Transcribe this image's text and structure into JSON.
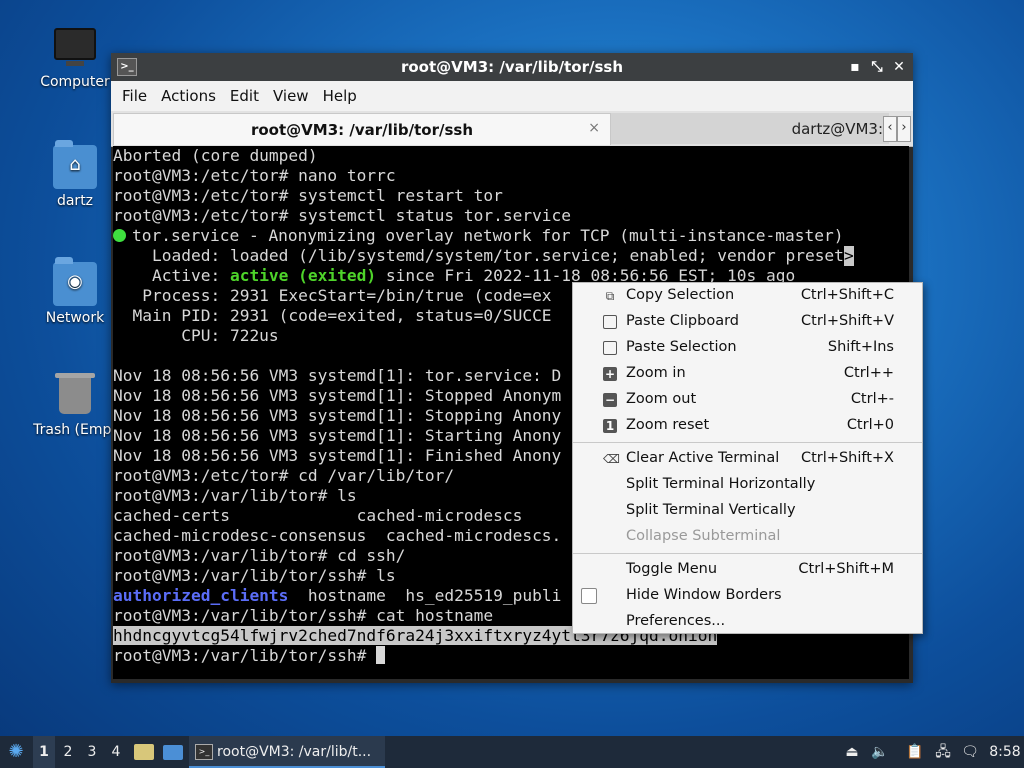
{
  "desktop": {
    "icons": [
      {
        "label": "Computer"
      },
      {
        "label": "dartz"
      },
      {
        "label": "Network"
      },
      {
        "label": "Trash (Empt"
      }
    ]
  },
  "window": {
    "title": "root@VM3: /var/lib/tor/ssh",
    "menu": [
      "File",
      "Actions",
      "Edit",
      "View",
      "Help"
    ],
    "tabs": [
      {
        "label": "root@VM3: /var/lib/tor/ssh",
        "close": "×"
      },
      {
        "label": "dartz@VM3:"
      }
    ],
    "controls": {
      "minimize": "▪",
      "maximize": "⤡",
      "close": "✕"
    }
  },
  "terminal": {
    "lines": [
      "Aborted (core dumped)",
      "root@VM3:/etc/tor# nano torrc",
      "root@VM3:/etc/tor# systemctl restart tor",
      "root@VM3:/etc/tor# systemctl status tor.service",
      "tor.service - Anonymizing overlay network for TCP (multi-instance-master)",
      "    Loaded: loaded (/lib/systemd/system/tor.service; enabled; vendor preset",
      "    Active: ",
      "active (exited)",
      " since Fri 2022-11-18 08:56:56 EST; 10s ago",
      "   Process: 2931 ExecStart=/bin/true (code=ex",
      "  Main PID: 2931 (code=exited, status=0/SUCCE",
      "       CPU: 722us",
      "",
      "Nov 18 08:56:56 VM3 systemd[1]: tor.service: D",
      "Nov 18 08:56:56 VM3 systemd[1]: Stopped Anonym",
      "Nov 18 08:56:56 VM3 systemd[1]: Stopping Anony",
      "Nov 18 08:56:56 VM3 systemd[1]: Starting Anony",
      "Nov 18 08:56:56 VM3 systemd[1]: Finished Anony",
      "root@VM3:/etc/tor# cd /var/lib/tor/",
      "root@VM3:/var/lib/tor# ls",
      "cached-certs             cached-microdescs",
      "cached-microdesc-consensus  cached-microdescs.",
      "root@VM3:/var/lib/tor# cd ssh/",
      "root@VM3:/var/lib/tor/ssh# ls",
      "authorized_clients",
      "  hostname  hs_ed25519_publi",
      "root@VM3:/var/lib/tor/ssh# cat hostname",
      "hhdncgyvtcg54lfwjrv2ched7ndf6ra24j3xxiftxryz4ytt3r7z6jqd.onion",
      "root@VM3:/var/lib/tor/ssh# "
    ],
    "overflow_marker": ">"
  },
  "context_menu": {
    "items": [
      {
        "icon": "⧉",
        "label": "Copy Selection",
        "shortcut": "Ctrl+Shift+C"
      },
      {
        "icon": "▢",
        "label": "Paste Clipboard",
        "shortcut": "Ctrl+Shift+V"
      },
      {
        "icon": "▢",
        "label": "Paste Selection",
        "shortcut": "Shift+Ins"
      },
      {
        "icon": "+",
        "label": "Zoom in",
        "shortcut": "Ctrl++"
      },
      {
        "icon": "−",
        "label": "Zoom out",
        "shortcut": "Ctrl+-"
      },
      {
        "icon": "1",
        "label": "Zoom reset",
        "shortcut": "Ctrl+0"
      },
      {
        "icon": "⌫",
        "label": "Clear Active Terminal",
        "shortcut": "Ctrl+Shift+X"
      },
      {
        "label": "Split Terminal Horizontally"
      },
      {
        "label": "Split Terminal Vertically"
      },
      {
        "label": "Collapse Subterminal"
      },
      {
        "label": "Toggle Menu",
        "shortcut": "Ctrl+Shift+M"
      },
      {
        "label": "Hide Window Borders"
      },
      {
        "label": "Preferences..."
      }
    ]
  },
  "taskbar": {
    "workspaces": [
      "1",
      "2",
      "3",
      "4"
    ],
    "task_label": "root@VM3: /var/lib/t...",
    "clock": "8:58"
  }
}
